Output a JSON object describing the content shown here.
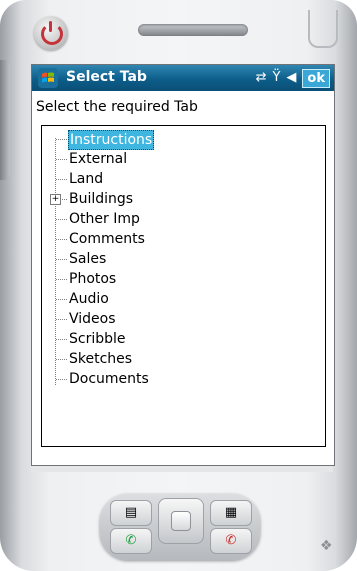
{
  "window": {
    "title": "Select Tab",
    "ok_label": "ok"
  },
  "status_icons": [
    "sync-icon",
    "signal-off-icon",
    "volume-icon"
  ],
  "prompt": "Select the required Tab",
  "tree": {
    "items": [
      {
        "label": "Instructions",
        "selected": true,
        "expandable": false
      },
      {
        "label": "External",
        "selected": false,
        "expandable": false
      },
      {
        "label": "Land",
        "selected": false,
        "expandable": false
      },
      {
        "label": "Buildings",
        "selected": false,
        "expandable": true
      },
      {
        "label": "Other Imp",
        "selected": false,
        "expandable": false
      },
      {
        "label": "Comments",
        "selected": false,
        "expandable": false
      },
      {
        "label": "Sales",
        "selected": false,
        "expandable": false
      },
      {
        "label": "Photos",
        "selected": false,
        "expandable": false
      },
      {
        "label": "Audio",
        "selected": false,
        "expandable": false
      },
      {
        "label": "Videos",
        "selected": false,
        "expandable": false
      },
      {
        "label": "Scribble",
        "selected": false,
        "expandable": false
      },
      {
        "label": "Sketches",
        "selected": false,
        "expandable": false
      },
      {
        "label": "Documents",
        "selected": false,
        "expandable": false
      }
    ]
  },
  "colors": {
    "titlebar": "#0d5e8a",
    "selection": "#3fb6e0"
  }
}
